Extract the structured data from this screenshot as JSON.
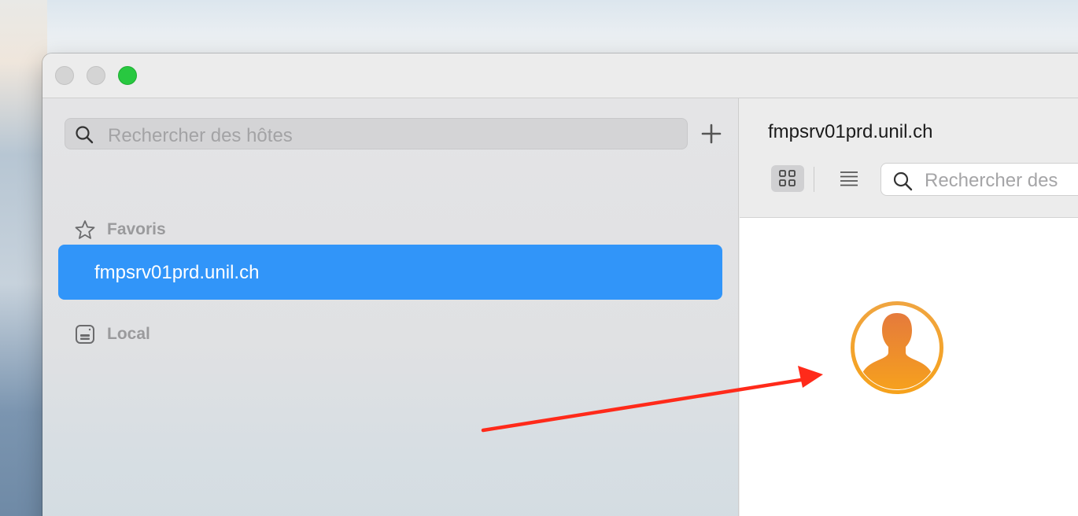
{
  "window": {
    "controls": [
      "close",
      "minimize",
      "maximize"
    ]
  },
  "sidebar": {
    "search_placeholder": "Rechercher des hôtes",
    "add_icon": "plus-icon",
    "favorites": {
      "label": "Favoris",
      "icon": "star-icon",
      "items": [
        {
          "label": "fmpsrv01prd.unil.ch",
          "selected": true
        }
      ]
    },
    "local": {
      "label": "Local",
      "icon": "drive-icon"
    }
  },
  "content": {
    "title": "fmpsrv01prd.unil.ch",
    "view_modes": [
      "grid-view-icon",
      "list-view-icon"
    ],
    "active_view": "grid",
    "search_placeholder": "Rechercher des",
    "avatar_icon": "user-avatar-icon"
  },
  "colors": {
    "selection": "#3195f9",
    "maximize": "#28c840",
    "avatar_gradient_top": "#e57a3c",
    "avatar_gradient_bottom": "#f8a51a",
    "annotation_arrow": "#ff2a1a"
  }
}
